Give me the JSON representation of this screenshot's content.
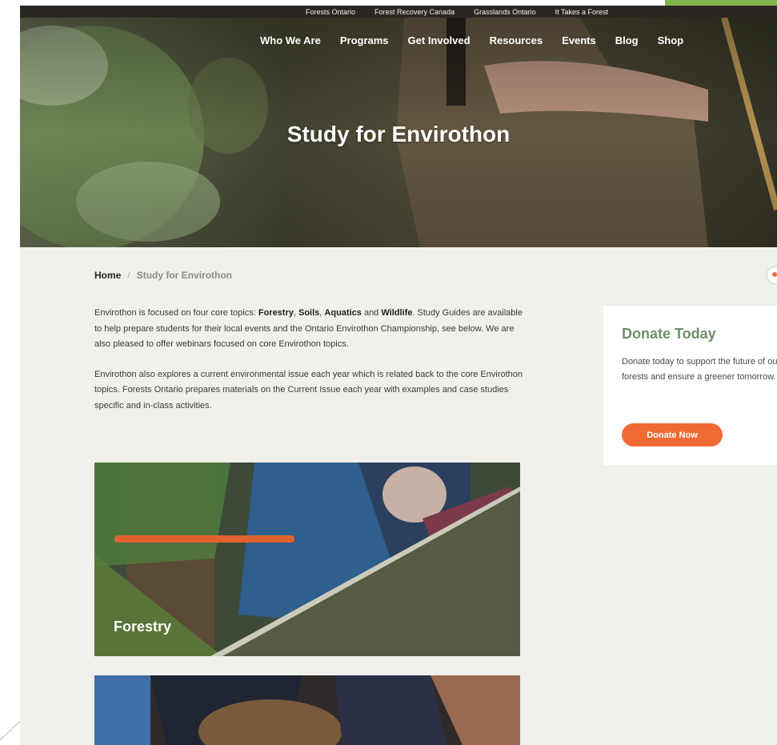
{
  "utility_nav": [
    "Forests Ontario",
    "Forest Recovery Canada",
    "Grasslands Ontario",
    "It Takes a Forest"
  ],
  "main_nav": [
    "Who We Are",
    "Programs",
    "Get Involved",
    "Resources",
    "Events",
    "Blog",
    "Shop"
  ],
  "hero": {
    "title": "Study for Envirothon"
  },
  "breadcrumb": {
    "home": "Home",
    "separator": "/",
    "current": "Study for Envirothon"
  },
  "intro": {
    "p1": {
      "lead": "Envirothon is focused on four core topics: ",
      "t1": "Forestry",
      "s1": ", ",
      "t2": "Soils",
      "s2": ", ",
      "t3": "Aquatics",
      "s3": " and ",
      "t4": "Wildlife",
      "tail": ". Study Guides are available to help prepare students for their local events and the Ontario Envirothon Championship, see below. We are also pleased to offer webinars focused on core Envirothon topics."
    },
    "p2": "Envirothon also explores a current environmental issue each year which is related back to the core Envirothon topics. Forests Ontario prepares materials on the Current Issue each year with examples and case studies specific and in-class activities."
  },
  "topics": [
    {
      "label": "Forestry"
    },
    {
      "label": ""
    }
  ],
  "donate": {
    "title": "Donate Today",
    "text": "Donate today to support the future of our forests and ensure a greener tomorrow.",
    "button": "Donate Now"
  },
  "colors": {
    "accent": "#f06a35",
    "donate_title": "#6f8f68",
    "utility_accent": "#7fb54b",
    "page_bg": "#f1f1ec"
  }
}
